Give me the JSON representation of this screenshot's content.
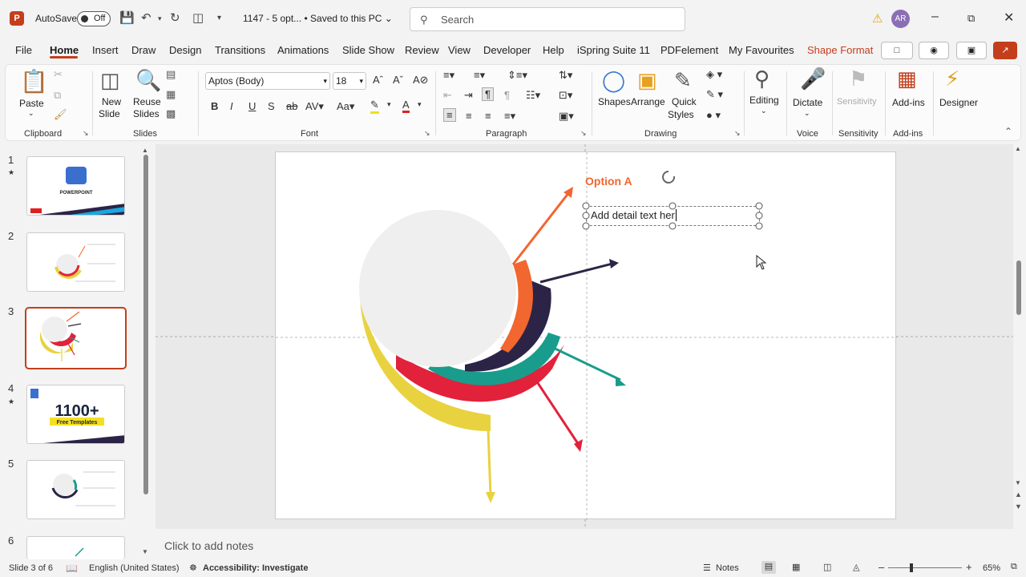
{
  "titlebar": {
    "app_icon": "P",
    "autosave_label": "AutoSave",
    "autosave_state": "Off",
    "doc_title": "1147 - 5 opt... • Saved to this PC",
    "search_placeholder": "Search",
    "avatar_initials": "AR"
  },
  "tabs": [
    "File",
    "Home",
    "Insert",
    "Draw",
    "Design",
    "Transitions",
    "Animations",
    "Slide Show",
    "Review",
    "View",
    "Developer",
    "Help",
    "iSpring Suite 11",
    "PDFelement",
    "My Favourites",
    "Shape Format"
  ],
  "ribbon": {
    "clipboard": {
      "paste": "Paste",
      "group": "Clipboard"
    },
    "slides": {
      "new_slide": "New",
      "new_slide2": "Slide",
      "reuse": "Reuse",
      "reuse2": "Slides",
      "group": "Slides"
    },
    "font": {
      "family": "Aptos (Body)",
      "size": "18",
      "group": "Font"
    },
    "paragraph": {
      "group": "Paragraph"
    },
    "drawing": {
      "shapes": "Shapes",
      "arrange": "Arrange",
      "quick": "Quick",
      "quick2": "Styles",
      "group": "Drawing"
    },
    "editing": {
      "label": "Editing"
    },
    "voice": {
      "dictate": "Dictate",
      "group": "Voice"
    },
    "sensitivity": {
      "label": "Sensitivity",
      "group": "Sensitivity"
    },
    "addins": {
      "label": "Add-ins",
      "group": "Add-ins"
    },
    "designer": {
      "label": "Designer"
    }
  },
  "thumbnails": [
    {
      "num": "1",
      "starred": true
    },
    {
      "num": "2",
      "starred": false
    },
    {
      "num": "3",
      "starred": false,
      "selected": true
    },
    {
      "num": "4",
      "starred": true
    },
    {
      "num": "5",
      "starred": false
    },
    {
      "num": "6",
      "starred": false
    }
  ],
  "thumb_text": {
    "t1_title": "POWERPOINT",
    "t4_big": "1100+",
    "t4_sub": "Free Templates"
  },
  "slide": {
    "option_label": "Option A",
    "textbox_text": "Add detail text her",
    "colors": {
      "orange": "#f2662f",
      "navy": "#2c2447",
      "teal": "#1a9c8c",
      "red": "#e2213a",
      "yellow": "#e8d23f",
      "circle": "#efefef"
    }
  },
  "notes_placeholder": "Click to add notes",
  "status": {
    "slide_of": "Slide 3 of 6",
    "language": "English (United States)",
    "accessibility": "Accessibility: Investigate",
    "notes": "Notes",
    "zoom": "65%"
  },
  "colors": {
    "accent": "#c43e1c"
  }
}
